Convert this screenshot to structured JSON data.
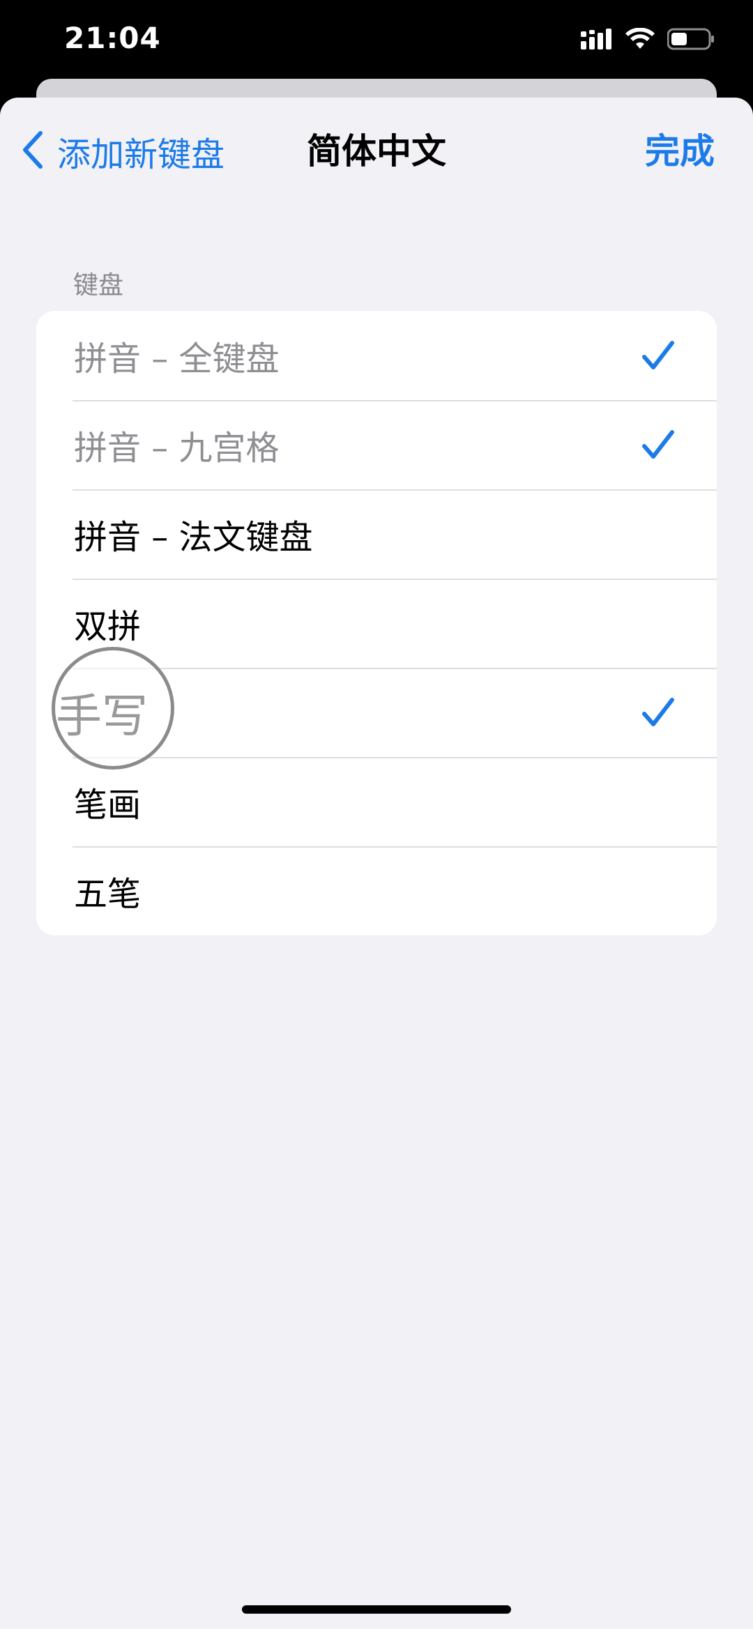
{
  "status_bar": {
    "time": "21:04",
    "icons": [
      "cellular-signal-icon",
      "wifi-icon",
      "battery-icon"
    ]
  },
  "nav": {
    "back_label": "添加新键盘",
    "title": "简体中文",
    "done_label": "完成"
  },
  "section": {
    "header": "键盘"
  },
  "keyboards": [
    {
      "label": "拼音 – 全键盘",
      "checked": true,
      "muted": true
    },
    {
      "label": "拼音 – 九宫格",
      "checked": true,
      "muted": true
    },
    {
      "label": "拼音 – 法文键盘",
      "checked": false,
      "muted": false
    },
    {
      "label": "双拼",
      "checked": false,
      "muted": false
    },
    {
      "label": "手写",
      "checked": true,
      "muted": false
    },
    {
      "label": "笔画",
      "checked": false,
      "muted": false
    },
    {
      "label": "五笔",
      "checked": false,
      "muted": false
    }
  ],
  "colors": {
    "accent": "#1c7be8",
    "background": "#f1f1f6",
    "muted_text": "#8e8e93"
  }
}
